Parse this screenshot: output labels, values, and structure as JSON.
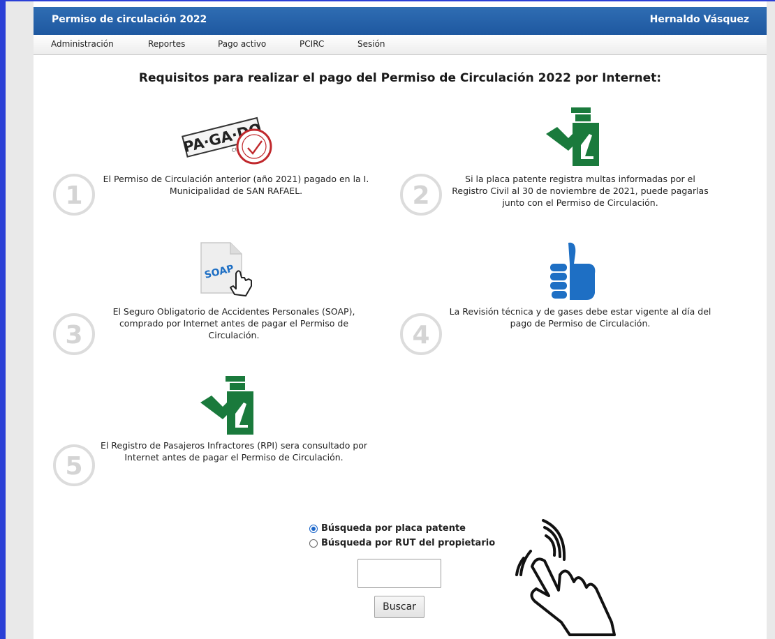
{
  "header": {
    "title": "Permiso de circulación 2022",
    "user": "Hernaldo Vásquez"
  },
  "menu": [
    {
      "label": "Administración"
    },
    {
      "label": "Reportes"
    },
    {
      "label": "Pago activo"
    },
    {
      "label": "PCIRC"
    },
    {
      "label": "Sesión"
    }
  ],
  "heading": "Requisitos para realizar el pago del Permiso de Circulación 2022 por Internet:",
  "requirements": [
    {
      "number": "1",
      "icon": "pagado-stamp-icon",
      "stamp_text": "PA·GA·DO",
      "stamp_sub": "CHILE",
      "text": "El Permiso de Circulación anterior (año 2021) pagado en la I. Municipalidad de SAN RAFAEL."
    },
    {
      "number": "2",
      "icon": "inspector-icon",
      "text": "Si la placa patente registra multas informadas por el Registro Civil al 30 de noviembre de 2021, puede pagarlas junto con el Permiso de Circulación."
    },
    {
      "number": "3",
      "icon": "soap-document-icon",
      "doc_text": "SOAP",
      "text": "El Seguro Obligatorio de Accidentes Personales (SOAP), comprado por Internet antes de pagar el Permiso de Circulación."
    },
    {
      "number": "4",
      "icon": "thumbs-up-icon",
      "text": "La Revisión técnica y de gases debe estar vigente al día del pago de Permiso de Circulación."
    },
    {
      "number": "5",
      "icon": "inspector-icon",
      "text": "El Registro de Pasajeros Infractores (RPI) sera consultado por Internet antes de pagar el Permiso de Circulación."
    }
  ],
  "search": {
    "options": [
      {
        "label": "Búsqueda por placa patente",
        "checked": true
      },
      {
        "label": "Búsqueda por RUT del propietario",
        "checked": false
      }
    ],
    "input_value": "",
    "button_label": "Buscar"
  },
  "colors": {
    "header": "#1e58a0",
    "inspector": "#1a7a3c",
    "thumb": "#1e6fc4",
    "stamp": "#c0282c"
  }
}
